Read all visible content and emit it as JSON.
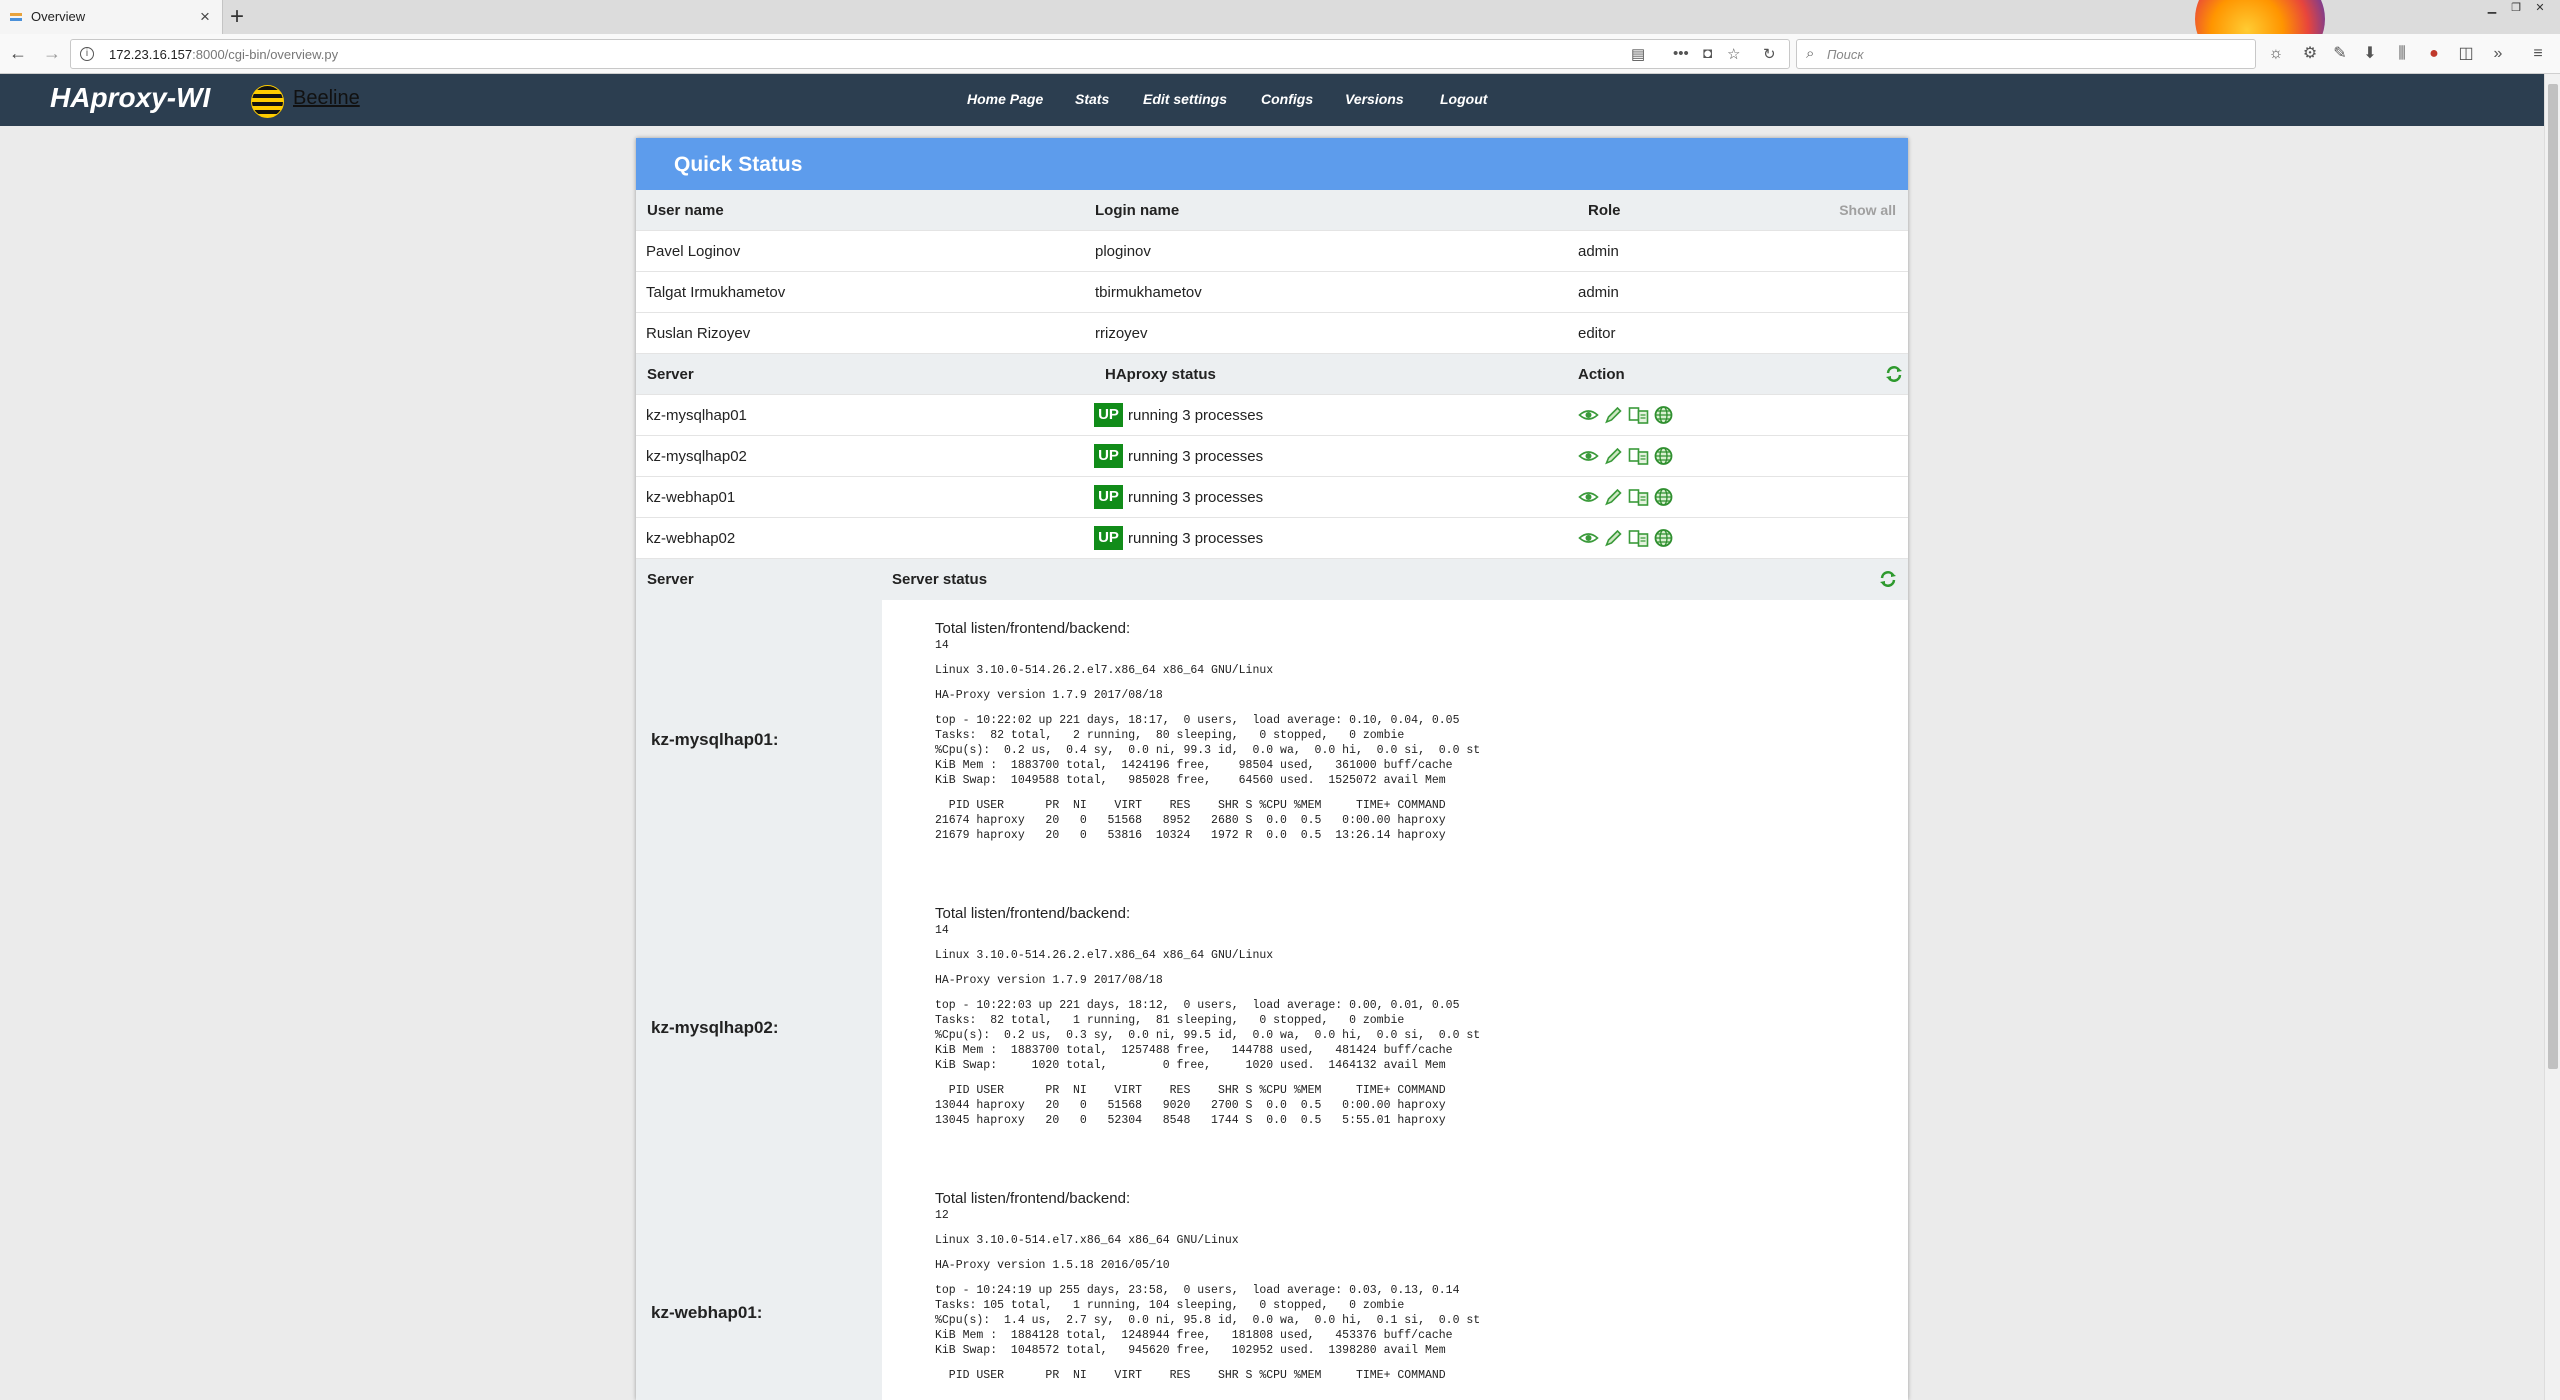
{
  "browser": {
    "tab_title": "Overview",
    "url_host": "172.23.16.157",
    "url_rest": ":8000/cgi-bin/overview.py",
    "search_placeholder": "Поиск"
  },
  "app": {
    "logo": "HAproxy-WI",
    "brand": "Beeline",
    "menu": [
      "Home Page",
      "Stats",
      "Edit settings",
      "Configs",
      "Versions",
      "Logout"
    ]
  },
  "quick_status": {
    "title": "Quick Status",
    "users_header": {
      "user": "User name",
      "login": "Login name",
      "role": "Role",
      "show_all": "Show all"
    },
    "users": [
      {
        "name": "Pavel Loginov",
        "login": "ploginov",
        "role": "admin"
      },
      {
        "name": "Talgat Irmukhametov",
        "login": "tbirmukhametov",
        "role": "admin"
      },
      {
        "name": "Ruslan Rizoyev",
        "login": "rrizoyev",
        "role": "editor"
      }
    ],
    "servers_header": {
      "server": "Server",
      "status": "HAproxy status",
      "action": "Action"
    },
    "servers": [
      {
        "name": "kz-mysqlhap01",
        "badge": "UP",
        "status": "running 3 processes"
      },
      {
        "name": "kz-mysqlhap02",
        "badge": "UP",
        "status": "running 3 processes"
      },
      {
        "name": "kz-webhap01",
        "badge": "UP",
        "status": "running 3 processes"
      },
      {
        "name": "kz-webhap02",
        "badge": "UP",
        "status": "running 3 processes"
      }
    ],
    "server_status_header": {
      "server": "Server",
      "status": "Server status"
    },
    "server_status": [
      {
        "name": "kz-mysqlhap01:",
        "listen_title": "Total listen/frontend/backend:",
        "listen_count": "14",
        "kernel": "Linux 3.10.0-514.26.2.el7.x86_64 x86_64 GNU/Linux",
        "haproxy_version": "HA-Proxy version 1.7.9 2017/08/18",
        "top": "top - 10:22:02 up 221 days, 18:17,  0 users,  load average: 0.10, 0.04, 0.05\nTasks:  82 total,   2 running,  80 sleeping,   0 stopped,   0 zombie\n%Cpu(s):  0.2 us,  0.4 sy,  0.0 ni, 99.3 id,  0.0 wa,  0.0 hi,  0.0 si,  0.0 st\nKiB Mem :  1883700 total,  1424196 free,    98504 used,   361000 buff/cache\nKiB Swap:  1049588 total,   985028 free,    64560 used.  1525072 avail Mem",
        "procs": "  PID USER      PR  NI    VIRT    RES    SHR S %CPU %MEM     TIME+ COMMAND\n21674 haproxy   20   0   51568   8952   2680 S  0.0  0.5   0:00.00 haproxy\n21679 haproxy   20   0   53816  10324   1972 R  0.0  0.5  13:26.14 haproxy"
      },
      {
        "name": "kz-mysqlhap02:",
        "listen_title": "Total listen/frontend/backend:",
        "listen_count": "14",
        "kernel": "Linux 3.10.0-514.26.2.el7.x86_64 x86_64 GNU/Linux",
        "haproxy_version": "HA-Proxy version 1.7.9 2017/08/18",
        "top": "top - 10:22:03 up 221 days, 18:12,  0 users,  load average: 0.00, 0.01, 0.05\nTasks:  82 total,   1 running,  81 sleeping,   0 stopped,   0 zombie\n%Cpu(s):  0.2 us,  0.3 sy,  0.0 ni, 99.5 id,  0.0 wa,  0.0 hi,  0.0 si,  0.0 st\nKiB Mem :  1883700 total,  1257488 free,   144788 used,   481424 buff/cache\nKiB Swap:     1020 total,        0 free,     1020 used.  1464132 avail Mem",
        "procs": "  PID USER      PR  NI    VIRT    RES    SHR S %CPU %MEM     TIME+ COMMAND\n13044 haproxy   20   0   51568   9020   2700 S  0.0  0.5   0:00.00 haproxy\n13045 haproxy   20   0   52304   8548   1744 S  0.0  0.5   5:55.01 haproxy"
      },
      {
        "name": "kz-webhap01:",
        "listen_title": "Total listen/frontend/backend:",
        "listen_count": "12",
        "kernel": "Linux 3.10.0-514.el7.x86_64 x86_64 GNU/Linux",
        "haproxy_version": "HA-Proxy version 1.5.18 2016/05/10",
        "top": "top - 10:24:19 up 255 days, 23:58,  0 users,  load average: 0.03, 0.13, 0.14\nTasks: 105 total,   1 running, 104 sleeping,   0 stopped,   0 zombie\n%Cpu(s):  1.4 us,  2.7 sy,  0.0 ni, 95.8 id,  0.0 wa,  0.0 hi,  0.1 si,  0.0 st\nKiB Mem :  1884128 total,  1248944 free,   181808 used,   453376 buff/cache\nKiB Swap:  1048572 total,   945620 free,   102952 used.  1398280 avail Mem",
        "procs": "  PID USER      PR  NI    VIRT    RES    SHR S %CPU %MEM     TIME+ COMMAND"
      }
    ]
  }
}
